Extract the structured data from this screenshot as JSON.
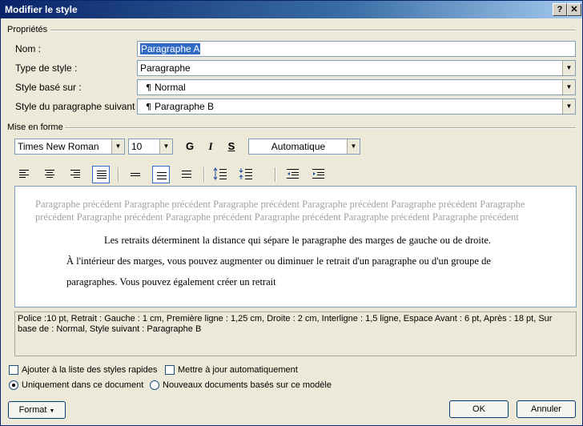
{
  "window": {
    "title": "Modifier le style",
    "help": "?",
    "close": "✕"
  },
  "properties": {
    "section": "Propriétés",
    "name_label": "Nom :",
    "name_value": "Paragraphe A",
    "type_label": "Type de style :",
    "type_value": "Paragraphe",
    "based_label": "Style basé sur :",
    "based_value": "Normal",
    "next_label": "Style du paragraphe suivant :",
    "next_value": "Paragraphe B",
    "para_glyph": "¶"
  },
  "formatting": {
    "section": "Mise en forme",
    "font": "Times New Roman",
    "size": "10",
    "bold": "G",
    "italic": "I",
    "underline": "S",
    "color": "Automatique"
  },
  "preview": {
    "previous": "Paragraphe précédent Paragraphe précédent Paragraphe précédent Paragraphe précédent Paragraphe précédent Paragraphe précédent Paragraphe précédent Paragraphe précédent Paragraphe précédent Paragraphe précédent Paragraphe précédent",
    "sample": "Les retraits déterminent la distance qui sépare le paragraphe des marges de gauche ou de droite. À l'intérieur des marges, vous pouvez augmenter ou diminuer le retrait d'un paragraphe ou d'un groupe de paragraphes. Vous pouvez également créer un retrait"
  },
  "description": "Police :10 pt, Retrait : Gauche :  1 cm, Première ligne : 1,25 cm, Droite :  2 cm, Interligne : 1,5 ligne, Espace Avant : 6 pt, Après : 18 pt, Sur base de : Normal, Style suivant : Paragraphe B",
  "options": {
    "add_quick": "Ajouter à la liste des styles rapides",
    "auto_update": "Mettre à jour automatiquement",
    "this_doc": "Uniquement dans ce document",
    "new_docs": "Nouveaux documents basés sur ce modèle"
  },
  "buttons": {
    "format": "Format",
    "ok": "OK",
    "cancel": "Annuler"
  }
}
